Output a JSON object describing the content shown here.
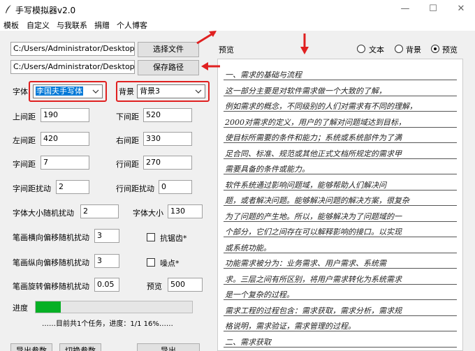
{
  "window": {
    "title": "手写模拟器v2.0",
    "minimize_glyph": "—",
    "maximize_glyph": "☐",
    "close_glyph": "✕"
  },
  "menu": [
    "模板",
    "自定义",
    "与我联系",
    "捐赠",
    "个人博客"
  ],
  "files": {
    "text_path": "C:/Users/Administrator/Desktop/新",
    "save_path": "C:/Users/Administrator/Desktop/新",
    "choose_file_label": "选择文件",
    "save_path_label": "保存路径"
  },
  "font": {
    "label": "字体",
    "value": "李国夫手写体"
  },
  "background": {
    "label": "背景",
    "value": "背景3"
  },
  "params": {
    "top_margin_label": "上间距",
    "top_margin": "190",
    "bottom_margin_label": "下间距",
    "bottom_margin": "520",
    "left_margin_label": "左间距",
    "left_margin": "420",
    "right_margin_label": "右间距",
    "right_margin": "330",
    "char_spacing_label": "字间距",
    "char_spacing": "7",
    "line_spacing_label": "行间距",
    "line_spacing": "270",
    "char_jitter_label": "字间距扰动",
    "char_jitter": "2",
    "line_jitter_label": "行间距扰动",
    "line_jitter": "0",
    "size_jitter_label": "字体大小随机扰动",
    "size_jitter": "2",
    "font_size_label": "字体大小",
    "font_size": "130",
    "stroke_h_label": "笔画横向偏移随机扰动",
    "stroke_h": "3",
    "stroke_v_label": "笔画纵向偏移随机扰动",
    "stroke_v": "3",
    "stroke_rot_label": "笔画旋转偏移随机扰动",
    "stroke_rot": "0.05",
    "antialias_label": "抗锯齿*",
    "noise_label": "噪点*",
    "preview_label": "预览",
    "preview_value": "500"
  },
  "progress": {
    "label": "进度",
    "fraction": 0.16,
    "status": "……目前共1个任务，进度：1/1  16%……"
  },
  "bottom_buttons": [
    "导出参数",
    "切换参数",
    "导出"
  ],
  "preview_panel": {
    "title": "预览",
    "modes": [
      {
        "label": "文本",
        "selected": false
      },
      {
        "label": "背景",
        "selected": false
      },
      {
        "label": "预览",
        "selected": true
      }
    ],
    "lines": [
      "一、需求的基础与流程",
      "    这一部分主要是对软件需求做一个大致的了解，",
      "例如需求的概念，不同级别的人们对需求有不同的理解，",
      "2000对需求的定义，用户的了解对问题域达到目标，",
      "使目标所需要的条件和能力；系统或系统部件为了满",
      "足合同、标准、规范或其他正式文档所规定的需求甲",
      "需要具备的条件或能力。",
      "    软件系统通过影响问题域，能够帮助人们解决问",
      "题，或者解决问题。能够解决问题的解决方案，很复杂",
      "为了问题的产生地。所以，能够解决为了问题域的一",
      "个部分，它们之间存在可以解释影响的接口。以实现",
      "或系统功能。",
      "    功能需求被分为：业务需求、用户需求、系统需",
      "求。三层之间有所区别，将用户需求转化为系统需求",
      "是一个复杂的过程。",
      "需求工程的过程包含：需求获取，需求分析，需求规",
      "格说明，需求验证，需求管理的过程。",
      "二、需求获取"
    ]
  }
}
